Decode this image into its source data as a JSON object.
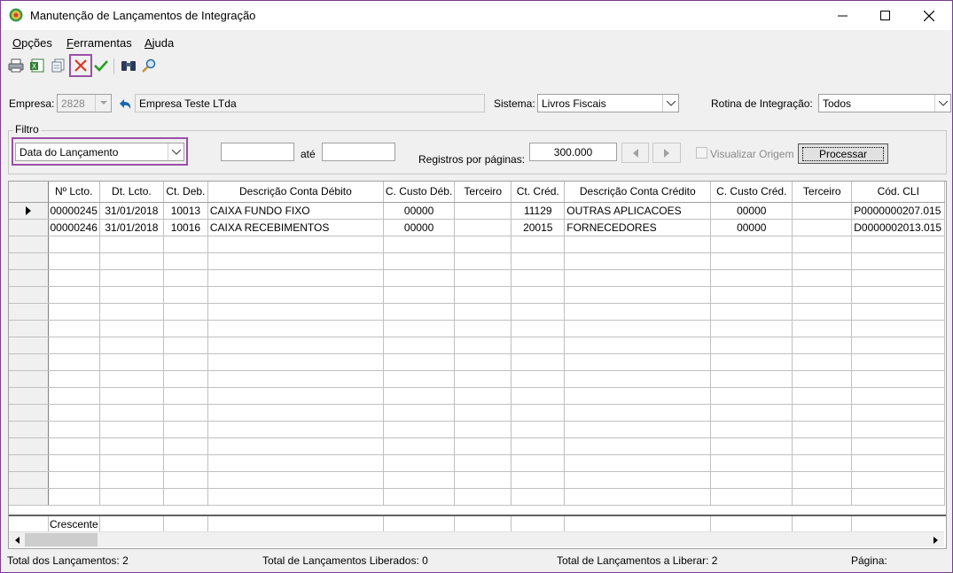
{
  "window": {
    "title": "Manutenção de Lançamentos de Integração"
  },
  "menu": [
    {
      "mnemonic": "O",
      "rest": "pções"
    },
    {
      "mnemonic": "F",
      "rest": "erramentas"
    },
    {
      "mnemonic": "A",
      "rest": "juda"
    }
  ],
  "toolbar": {
    "icons": [
      "printer-icon",
      "excel-export-icon",
      "copy-icon",
      "delete-icon",
      "confirm-icon",
      "binoculars-icon",
      "magnifier-icon"
    ]
  },
  "form": {
    "empresa_label": "Empresa:",
    "empresa_code": "2828",
    "empresa_name": "Empresa Teste LTda",
    "sistema_label": "Sistema:",
    "sistema_value": "Livros Fiscais",
    "rotina_label": "Rotina de Integração:",
    "rotina_value": "Todos"
  },
  "filtro": {
    "group_label": "Filtro",
    "field_value": "Data do Lançamento",
    "from_value": "",
    "ate_label": "até",
    "to_value": "",
    "registros_label": "Registros por páginas:",
    "registros_value": "300.000",
    "visualizar_label": "Visualizar Origem",
    "visualizar_checked": false,
    "processar_label": "Processar"
  },
  "grid": {
    "headers": [
      "Nº Lcto.",
      "Dt. Lcto.",
      "Ct. Deb.",
      "Descrição Conta Débito",
      "C. Custo Déb.",
      "Terceiro",
      "Ct. Créd.",
      "Descrição Conta Crédito",
      "C. Custo Créd.",
      "Terceiro",
      "Cód. CLI"
    ],
    "rows": [
      [
        "00000245",
        "31/01/2018",
        "10013",
        "CAIXA FUNDO FIXO",
        "00000",
        "",
        "11129",
        "OUTRAS APLICACOES",
        "00000",
        "",
        "P0000000207.015"
      ],
      [
        "00000246",
        "31/01/2018",
        "10016",
        "CAIXA RECEBIMENTOS",
        "00000",
        "",
        "20015",
        "FORNECEDORES",
        "00000",
        "",
        "D0000002013.015"
      ]
    ],
    "footer_label": "Crescente"
  },
  "status": {
    "total": "Total dos Lançamentos: 2",
    "liberados": "Total de Lançamentos Liberados: 0",
    "a_liberar": "Total de Lançamentos a Liberar: 2",
    "pagina": "Página:"
  }
}
